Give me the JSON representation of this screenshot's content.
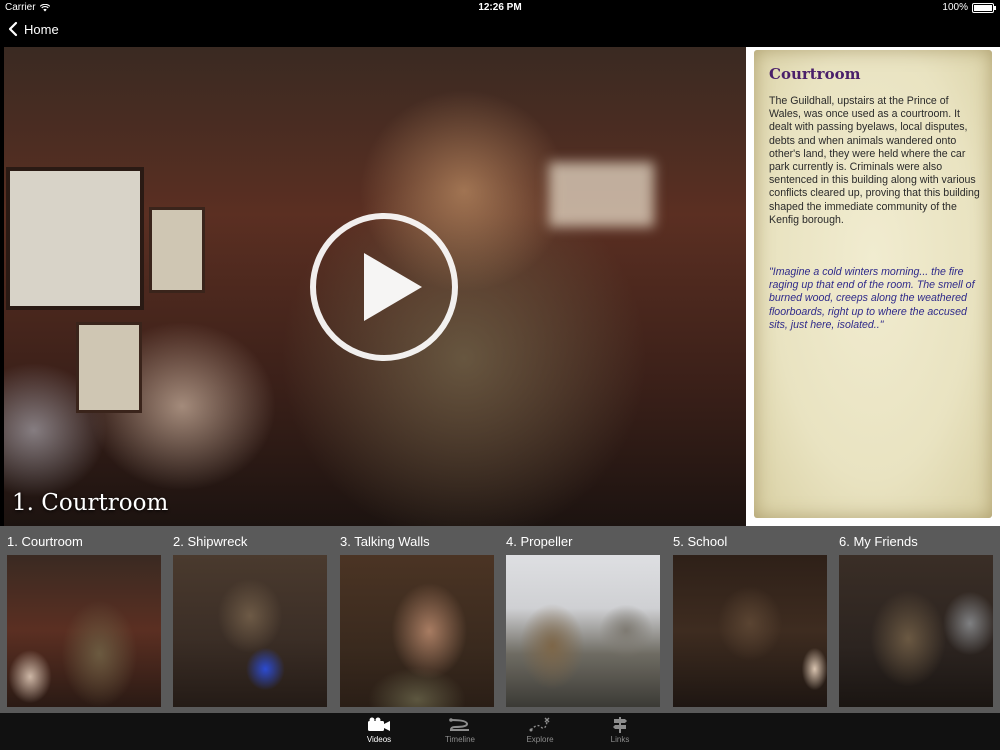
{
  "status": {
    "carrier": "Carrier",
    "time": "12:26 PM",
    "battery": "100%",
    "battery_level": 1.0
  },
  "nav": {
    "back_label": "Home"
  },
  "video": {
    "title": "1. Courtroom"
  },
  "info": {
    "title": "Courtroom",
    "body": "The Guildhall, upstairs at the Prince of Wales, was once used as a courtroom. It dealt with passing byelaws, local disputes, debts and when animals wandered onto other's land, they were held where the car park currently is. Criminals were also sentenced in this building along with various conflicts cleared up, proving that this building shaped the immediate community of the Kenfig borough.",
    "quote": "\"Imagine a cold winters morning... the fire raging up that end of the room. The smell of burned wood, creeps along the weathered floorboards, right up to where the accused sits, just here, isolated..\""
  },
  "videos": [
    {
      "label": "1. Courtroom"
    },
    {
      "label": "2. Shipwreck"
    },
    {
      "label": "3. Talking Walls"
    },
    {
      "label": "4. Propeller"
    },
    {
      "label": "5. School"
    },
    {
      "label": "6. My Friends"
    }
  ],
  "tabs": [
    {
      "label": "Videos",
      "icon": "video-camera-icon",
      "active": true
    },
    {
      "label": "Timeline",
      "icon": "timeline-icon",
      "active": false
    },
    {
      "label": "Explore",
      "icon": "map-path-icon",
      "active": false
    },
    {
      "label": "Links",
      "icon": "signpost-icon",
      "active": false
    }
  ]
}
